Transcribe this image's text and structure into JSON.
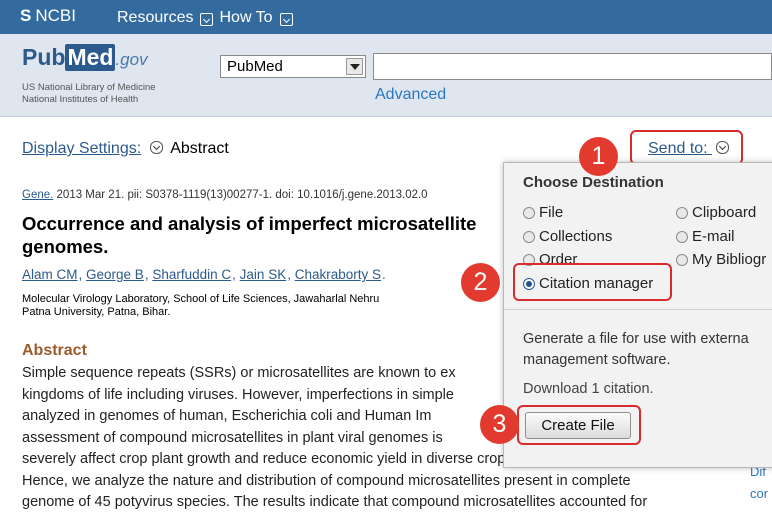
{
  "topbar": {
    "ncbi": "NCBI",
    "resources": "Resources",
    "howto": "How To"
  },
  "header": {
    "logo_pub": "Pub",
    "logo_med": "Med",
    "logo_gov": ".gov",
    "org_line1": "US National Library of Medicine",
    "org_line2": "National Institutes of Health",
    "db_select": "PubMed",
    "search_value": "",
    "advanced": "Advanced"
  },
  "display": {
    "label": "Display Settings:",
    "value": "Abstract"
  },
  "article": {
    "journal": "Gene.",
    "citation": " 2013 Mar 21. pii: S0378-1119(13)00277-1. doi: 10.1016/j.gene.2013.02.0",
    "title_line1": "Occurrence and analysis of imperfect microsatellite",
    "title_line2": "genomes.",
    "authors": [
      "Alam CM",
      "George B",
      "Sharfuddin C",
      "Jain SK",
      "Chakraborty S"
    ],
    "affil_line1": "Molecular Virology Laboratory, School of Life Sciences, Jawaharlal Nehru",
    "affil_line2": "Patna University, Patna, Bihar.",
    "abstract_head": "Abstract",
    "abstract_lines": [
      "Simple sequence repeats (SSRs) or microsatellites are known to ex",
      "kingdoms of life including viruses. However, imperfections in simple",
      "analyzed in genomes of human, Escherichia coli and Human Im",
      "assessment of compound microsatellites in plant viral genomes is",
      "severely affect crop plant growth and reduce economic yield in diverse cropping systems worldwide.",
      "Hence, we analyze the nature and distribution of compound microsatellites present in complete",
      "genome of 45 potyvirus species. The results indicate that compound microsatellites accounted for"
    ],
    "right_edge_1": "Dif",
    "right_edge_2": "cor"
  },
  "sendto": {
    "label": "Send to:"
  },
  "panel": {
    "heading": "Choose Destination",
    "options": {
      "file": "File",
      "clipboard": "Clipboard",
      "collections": "Collections",
      "email": "E-mail",
      "order": "Order",
      "bibliography": "My Bibliogr",
      "citation_manager": "Citation manager"
    },
    "description_line1": "Generate a file for use with externa",
    "description_line2": "management software.",
    "download": "Download 1 citation.",
    "create_button": "Create File"
  },
  "steps": {
    "one": "1",
    "two": "2",
    "three": "3"
  },
  "colors": {
    "topbar": "#336b9e",
    "annotation_red": "#e23a2e",
    "link": "#2c5a8c"
  }
}
